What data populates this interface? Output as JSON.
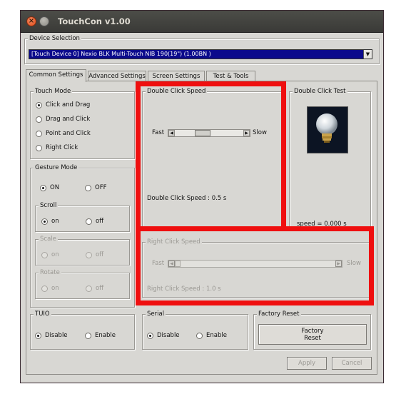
{
  "window": {
    "title": "TouchCon v1.00"
  },
  "device_selection": {
    "legend": "Device Selection",
    "selected": "[Touch Device 0] Nexio BLK Multi-Touch NIB 190(19\") (1.00BN  )"
  },
  "tabs": [
    {
      "label": "Common Settings",
      "active": true
    },
    {
      "label": "Advanced Settings",
      "active": false
    },
    {
      "label": "Screen Settings",
      "active": false
    },
    {
      "label": "Test & Tools",
      "active": false
    }
  ],
  "touch_mode": {
    "legend": "Touch Mode",
    "options": [
      "Click and Drag",
      "Drag and Click",
      "Point and Click",
      "Right Click"
    ],
    "selected_index": 0
  },
  "gesture_mode": {
    "legend": "Gesture Mode",
    "on_label": "ON",
    "off_label": "OFF",
    "scroll": {
      "legend": "Scroll",
      "on_label": "on",
      "off_label": "off"
    },
    "scale": {
      "legend": "Scale",
      "on_label": "on",
      "off_label": "off"
    },
    "rotate": {
      "legend": "Rotate",
      "on_label": "on",
      "off_label": "off"
    }
  },
  "double_click_speed": {
    "legend": "Double Click Speed",
    "fast_label": "Fast",
    "slow_label": "Slow",
    "value_text": "Double Click Speed : 0.5 s",
    "slider_position": 0.38
  },
  "right_click_speed": {
    "legend": "Right Click Speed",
    "fast_label": "Fast",
    "slow_label": "Slow",
    "value_text": "Right Click Speed : 1.0 s",
    "slider_position": 0.0
  },
  "double_click_test": {
    "legend": "Double Click Test",
    "speed_text": "speed = 0.000 s",
    "icon": "light-bulb-icon"
  },
  "tuio": {
    "legend": "TUIO",
    "disable_label": "Disable",
    "enable_label": "Enable"
  },
  "serial": {
    "legend": "Serial",
    "disable_label": "Disable",
    "enable_label": "Enable"
  },
  "factory_reset": {
    "legend": "Factory Reset",
    "button_line1": "Factory",
    "button_line2": "Reset"
  },
  "buttons": {
    "apply": "Apply",
    "cancel": "Cancel"
  },
  "colors": {
    "highlight_box": "#ef0f0f",
    "selection_bg": "#0b0a8c",
    "window_bg": "#d8d7d3"
  }
}
